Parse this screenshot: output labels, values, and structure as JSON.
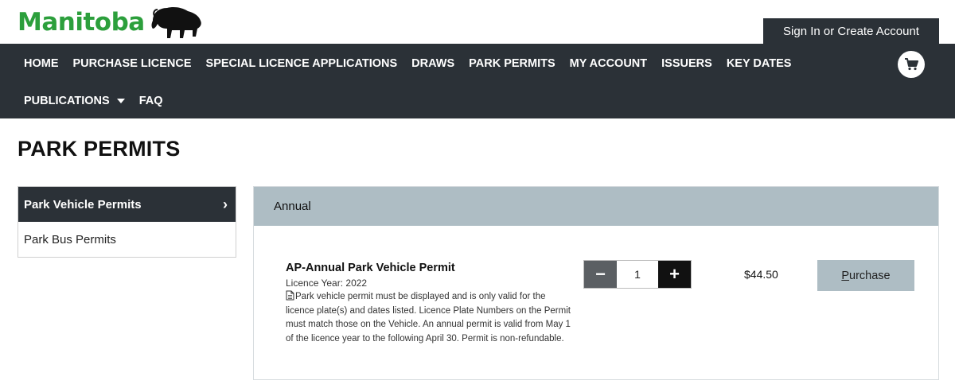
{
  "brand": {
    "name": "Manitoba",
    "color": "#2c9f3c",
    "logo_icon": "bison-icon"
  },
  "header": {
    "signin_label": "Sign In or Create Account"
  },
  "nav": {
    "row1": [
      "HOME",
      "PURCHASE LICENCE",
      "SPECIAL LICENCE APPLICATIONS",
      "DRAWS",
      "PARK PERMITS",
      "MY ACCOUNT",
      "ISSUERS",
      "KEY DATES"
    ],
    "row2": {
      "publications": "PUBLICATIONS",
      "faq": "FAQ"
    },
    "cart_icon": "cart-icon"
  },
  "page": {
    "title": "PARK PERMITS"
  },
  "sidebar": {
    "items": [
      {
        "label": "Park Vehicle Permits",
        "active": true
      },
      {
        "label": "Park Bus Permits",
        "active": false
      }
    ]
  },
  "panel": {
    "heading": "Annual",
    "product": {
      "title": "AP-Annual Park Vehicle Permit",
      "year": "Licence Year: 2022",
      "description": "Park vehicle permit must be displayed and is only valid for the licence plate(s) and dates listed. Licence Plate Numbers on the Permit must match those on the Vehicle. An annual permit is valid from May 1 of the licence year to the following April 30. Permit is non-refundable.",
      "quantity": "1",
      "price": "$44.50",
      "purchase_first": "P",
      "purchase_rest": "urchase"
    }
  },
  "colors": {
    "dark": "#2b3137",
    "panel_head": "#aebdc4",
    "brand_green": "#2c9f3c"
  }
}
